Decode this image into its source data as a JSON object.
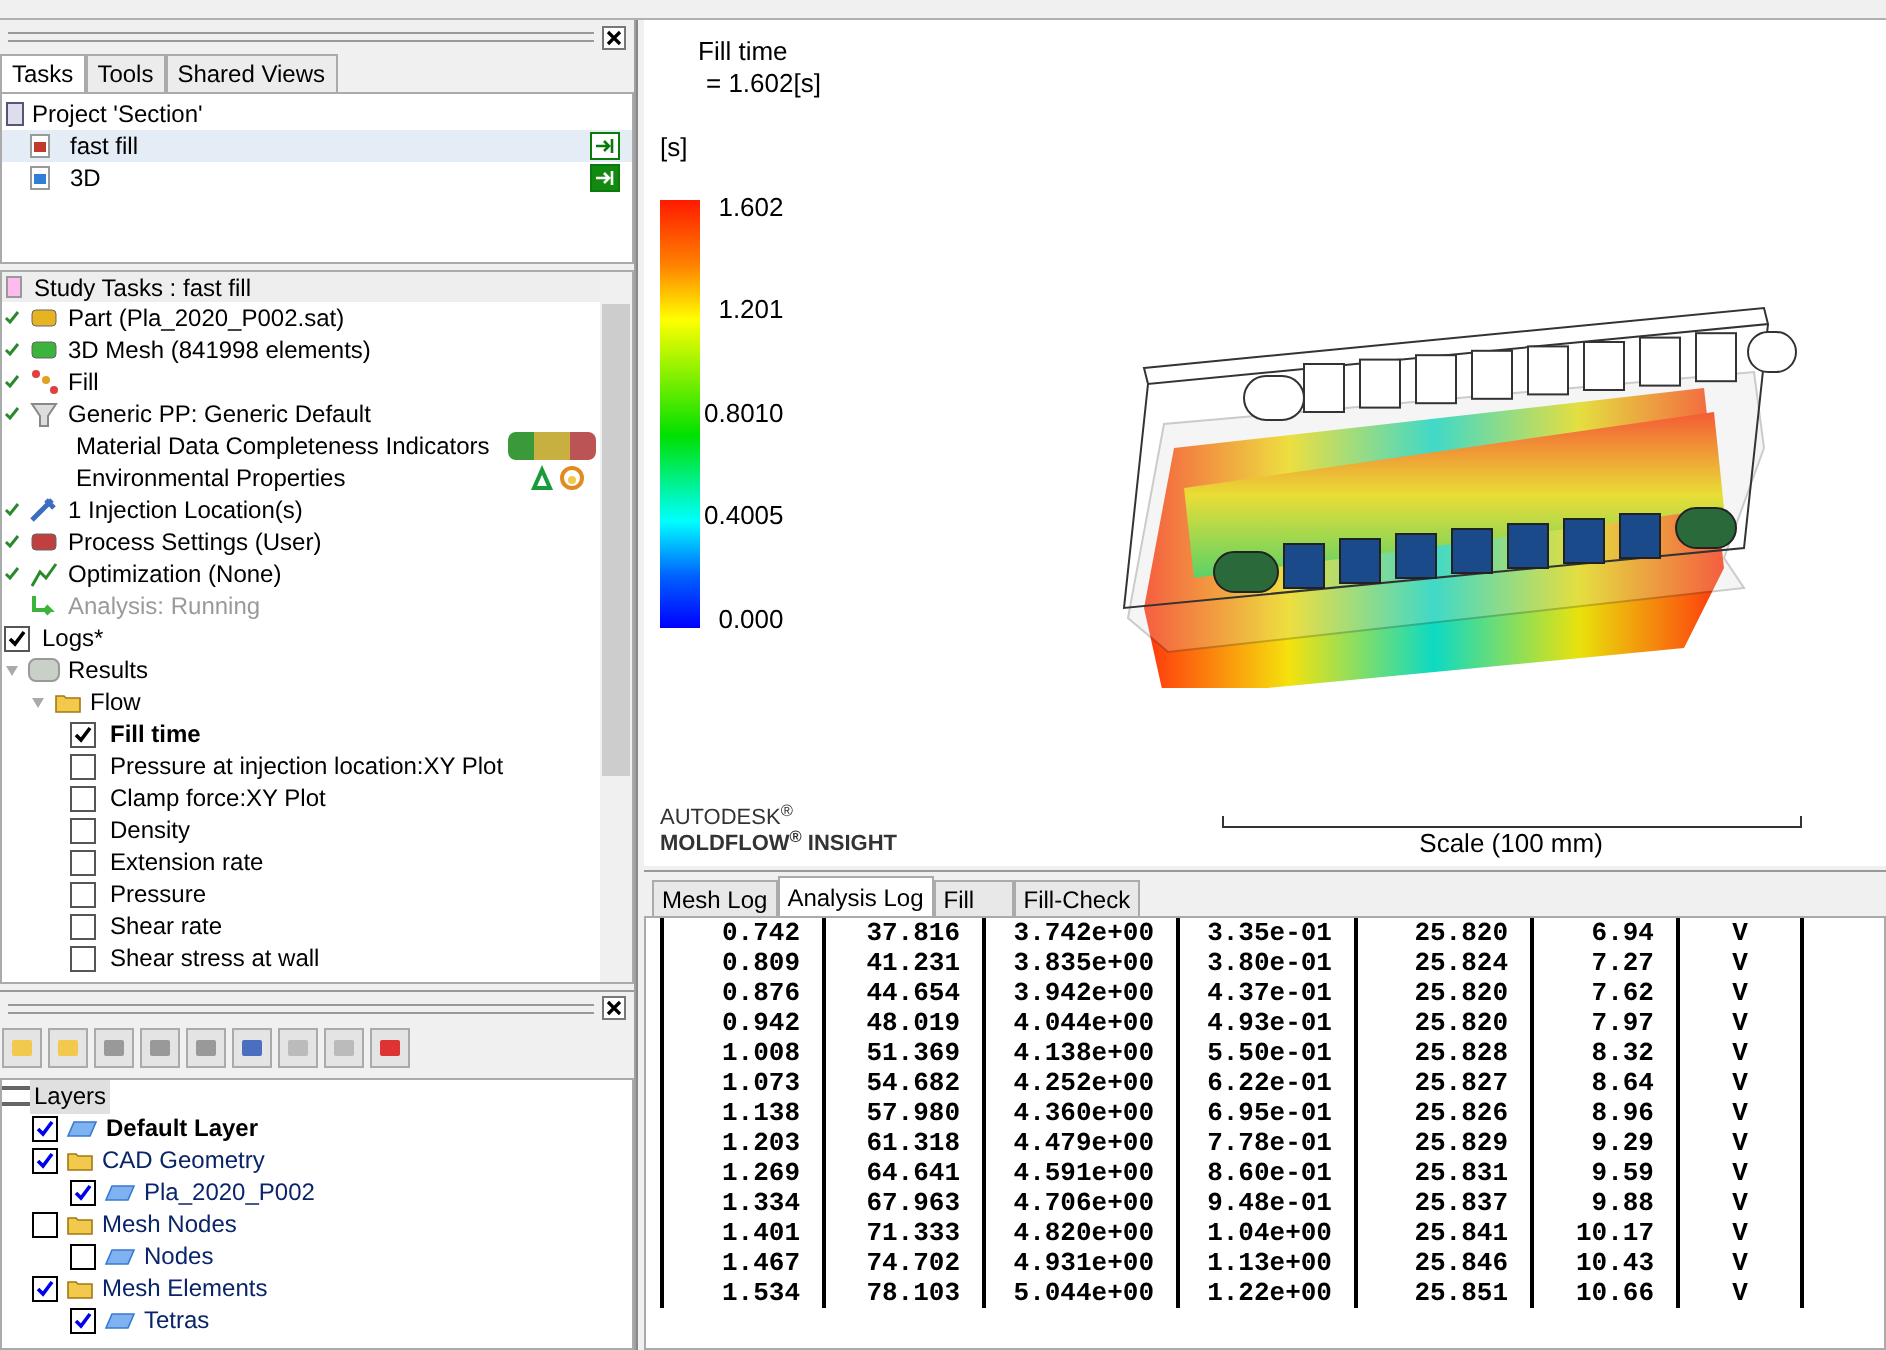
{
  "panel_tabs": [
    {
      "label": "Tasks",
      "selected": true
    },
    {
      "label": "Tools",
      "selected": false
    },
    {
      "label": "Shared Views",
      "selected": false
    }
  ],
  "project": {
    "title": "Project 'Section'",
    "studies": [
      {
        "name": "fast fill",
        "selected": true,
        "color": "#c0392b"
      },
      {
        "name": "3D",
        "selected": false,
        "color": "#2f7fd8"
      }
    ]
  },
  "study_tasks": {
    "title": "Study Tasks : fast fill",
    "items": [
      {
        "kind": "part",
        "label": "Part (Pla_2020_P002.sat)",
        "done": true,
        "disabled": false
      },
      {
        "kind": "mesh",
        "label": "3D Mesh (841998 elements)",
        "done": true,
        "disabled": false
      },
      {
        "kind": "fill",
        "label": "Fill",
        "done": true,
        "disabled": false
      },
      {
        "kind": "material",
        "label": "Generic PP: Generic Default",
        "done": true,
        "disabled": false
      },
      {
        "kind": "sub",
        "label": "Material Data Completeness Indicators",
        "done": false,
        "disabled": false
      },
      {
        "kind": "sub",
        "label": "Environmental Properties",
        "done": false,
        "disabled": false
      },
      {
        "kind": "injection",
        "label": "1 Injection Location(s)",
        "done": true,
        "disabled": false
      },
      {
        "kind": "process",
        "label": "Process Settings (User)",
        "done": true,
        "disabled": false
      },
      {
        "kind": "optimization",
        "label": "Optimization (None)",
        "done": true,
        "disabled": false
      },
      {
        "kind": "analysis",
        "label": "Analysis: Running",
        "done": false,
        "disabled": true
      }
    ]
  },
  "logs": {
    "label": "Logs*",
    "checked": true
  },
  "results": {
    "label": "Results",
    "expanded": true,
    "children": [
      {
        "label": "Flow",
        "expanded": true,
        "children": [
          {
            "label": "Fill time",
            "checked": true
          },
          {
            "label": "Pressure at injection location:XY Plot",
            "checked": false
          },
          {
            "label": "Clamp force:XY Plot",
            "checked": false
          },
          {
            "label": "Density",
            "checked": false
          },
          {
            "label": "Extension rate",
            "checked": false
          },
          {
            "label": "Pressure",
            "checked": false
          },
          {
            "label": "Shear rate",
            "checked": false
          },
          {
            "label": "Shear stress at wall",
            "checked": false
          }
        ]
      }
    ]
  },
  "layers": {
    "title": "Layers",
    "items": [
      {
        "kind": "layer",
        "label": "Default Layer",
        "checked": true,
        "active": true
      },
      {
        "kind": "folder",
        "label": "CAD Geometry",
        "checked": true,
        "active": false,
        "children": [
          {
            "label": "Pla_2020_P002",
            "checked": true,
            "active": false
          }
        ]
      },
      {
        "kind": "folder",
        "label": "Mesh Nodes",
        "checked": false,
        "active": false,
        "children": [
          {
            "label": "Nodes",
            "checked": false,
            "active": false
          }
        ]
      },
      {
        "kind": "folder",
        "label": "Mesh Elements",
        "checked": true,
        "active": false,
        "children": [
          {
            "label": "Tetras",
            "checked": true,
            "active": false
          }
        ]
      }
    ]
  },
  "viewer": {
    "result_title": "Fill time",
    "result_value": "= 1.602[s]",
    "unit": "[s]",
    "legend": [
      "1.602",
      "1.201",
      "0.8010",
      "0.4005",
      "0.000"
    ],
    "brand": "AUTODESK$^{®}$",
    "product": "MOLDFLOW$^{®}$ INSIGHT",
    "scale": "Scale (100 mm)"
  },
  "log_tabs": [
    {
      "label": "Mesh Log",
      "selected": false
    },
    {
      "label": "Analysis Log",
      "selected": true
    },
    {
      "label": "Fill",
      "selected": false
    },
    {
      "label": "Fill-Check",
      "selected": false
    }
  ],
  "log_rows": [
    [
      "0.742",
      "37.816",
      "3.742e+00",
      "3.35e-01",
      "25.820",
      "6.94",
      "V"
    ],
    [
      "0.809",
      "41.231",
      "3.835e+00",
      "3.80e-01",
      "25.824",
      "7.27",
      "V"
    ],
    [
      "0.876",
      "44.654",
      "3.942e+00",
      "4.37e-01",
      "25.820",
      "7.62",
      "V"
    ],
    [
      "0.942",
      "48.019",
      "4.044e+00",
      "4.93e-01",
      "25.820",
      "7.97",
      "V"
    ],
    [
      "1.008",
      "51.369",
      "4.138e+00",
      "5.50e-01",
      "25.828",
      "8.32",
      "V"
    ],
    [
      "1.073",
      "54.682",
      "4.252e+00",
      "6.22e-01",
      "25.827",
      "8.64",
      "V"
    ],
    [
      "1.138",
      "57.980",
      "4.360e+00",
      "6.95e-01",
      "25.826",
      "8.96",
      "V"
    ],
    [
      "1.203",
      "61.318",
      "4.479e+00",
      "7.78e-01",
      "25.829",
      "9.29",
      "V"
    ],
    [
      "1.269",
      "64.641",
      "4.591e+00",
      "8.60e-01",
      "25.831",
      "9.59",
      "V"
    ],
    [
      "1.334",
      "67.963",
      "4.706e+00",
      "9.48e-01",
      "25.837",
      "9.88",
      "V"
    ],
    [
      "1.401",
      "71.333",
      "4.820e+00",
      "1.04e+00",
      "25.841",
      "10.17",
      "V"
    ],
    [
      "1.467",
      "74.702",
      "4.931e+00",
      "1.13e+00",
      "25.846",
      "10.43",
      "V"
    ],
    [
      "1.534",
      "78.103",
      "5.044e+00",
      "1.22e+00",
      "25.851",
      "10.66",
      "V"
    ]
  ]
}
